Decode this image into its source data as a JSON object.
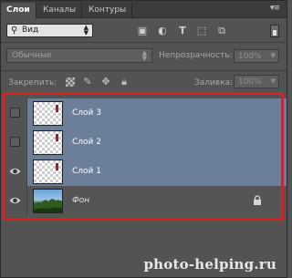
{
  "tabs": [
    {
      "label": "Слои",
      "active": true
    },
    {
      "label": "Каналы",
      "active": false
    },
    {
      "label": "Контуры",
      "active": false
    }
  ],
  "panel_menu_icon": "panel-menu-icon",
  "filter": {
    "kind_label": "Вид",
    "kind_icon": "search-icon",
    "filter_icons": [
      "image-filter-icon",
      "adjustment-filter-icon",
      "type-filter-icon",
      "shape-filter-icon",
      "smart-object-filter-icon"
    ]
  },
  "blend": {
    "mode": "Обычные",
    "opacity_label": "Непрозрачность:",
    "opacity_value": "100%"
  },
  "lock": {
    "label": "Закрепить:",
    "fill_label": "Заливка:",
    "fill_value": "100%",
    "icons": [
      "lock-transparent-icon",
      "lock-brush-icon",
      "lock-move-icon",
      "lock-all-icon"
    ]
  },
  "layers": [
    {
      "name": "Слой 3",
      "visible": false,
      "selected": true
    },
    {
      "name": "Слой 2",
      "visible": false,
      "selected": true
    },
    {
      "name": "Слой 1",
      "visible": true,
      "selected": true
    },
    {
      "name": "Фон",
      "visible": true,
      "selected": false,
      "locked": true
    }
  ],
  "colors": {
    "selection": "#6b7e9a",
    "highlight": "#d8202a",
    "panel": "#535353"
  },
  "watermark": "photo-helping.ru"
}
